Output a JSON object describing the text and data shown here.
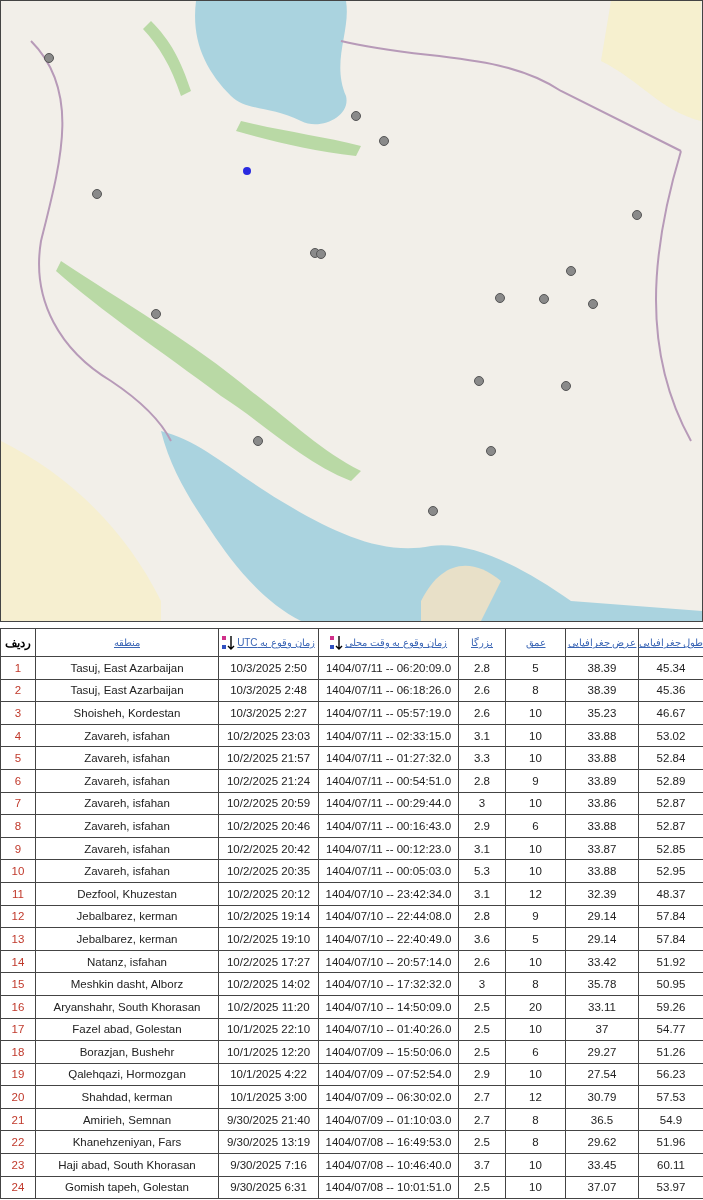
{
  "map": {
    "kind": "street-map"
  },
  "table": {
    "columns": [
      {
        "label": "ردیف",
        "link": false,
        "sortable": false
      },
      {
        "label": "منطقه",
        "link": true,
        "sortable": false
      },
      {
        "label": "زمان وقوع به UTC",
        "link": true,
        "sortable": true
      },
      {
        "label": "زمان وقوع به وقت محلی",
        "link": true,
        "sortable": true
      },
      {
        "label": "بزرگا",
        "link": true,
        "sortable": false
      },
      {
        "label": "عمق",
        "link": true,
        "sortable": false
      },
      {
        "label": "عرض جغرافیایی",
        "link": true,
        "sortable": false
      },
      {
        "label": "طول جغرافیایی",
        "link": true,
        "sortable": false
      }
    ],
    "rows": [
      [
        "1",
        "Tasuj, East Azarbaijan",
        "10/3/2025 2:50",
        "1404/07/11 -- 06:20:09.0",
        "2.8",
        "5",
        "38.39",
        "45.34"
      ],
      [
        "2",
        "Tasuj, East Azarbaijan",
        "10/3/2025 2:48",
        "1404/07/11 -- 06:18:26.0",
        "2.6",
        "8",
        "38.39",
        "45.36"
      ],
      [
        "3",
        "Shoisheh, Kordestan",
        "10/3/2025 2:27",
        "1404/07/11 -- 05:57:19.0",
        "2.6",
        "10",
        "35.23",
        "46.67"
      ],
      [
        "4",
        "Zavareh, isfahan",
        "10/2/2025 23:03",
        "1404/07/11 -- 02:33:15.0",
        "3.1",
        "10",
        "33.88",
        "53.02"
      ],
      [
        "5",
        "Zavareh, isfahan",
        "10/2/2025 21:57",
        "1404/07/11 -- 01:27:32.0",
        "3.3",
        "10",
        "33.88",
        "52.84"
      ],
      [
        "6",
        "Zavareh, isfahan",
        "10/2/2025 21:24",
        "1404/07/11 -- 00:54:51.0",
        "2.8",
        "9",
        "33.89",
        "52.89"
      ],
      [
        "7",
        "Zavareh, isfahan",
        "10/2/2025 20:59",
        "1404/07/11 -- 00:29:44.0",
        "3",
        "10",
        "33.86",
        "52.87"
      ],
      [
        "8",
        "Zavareh, isfahan",
        "10/2/2025 20:46",
        "1404/07/11 -- 00:16:43.0",
        "2.9",
        "6",
        "33.88",
        "52.87"
      ],
      [
        "9",
        "Zavareh, isfahan",
        "10/2/2025 20:42",
        "1404/07/11 -- 00:12:23.0",
        "3.1",
        "10",
        "33.87",
        "52.85"
      ],
      [
        "10",
        "Zavareh, isfahan",
        "10/2/2025 20:35",
        "1404/07/11 -- 00:05:03.0",
        "5.3",
        "10",
        "33.88",
        "52.95"
      ],
      [
        "11",
        "Dezfool, Khuzestan",
        "10/2/2025 20:12",
        "1404/07/10 -- 23:42:34.0",
        "3.1",
        "12",
        "32.39",
        "48.37"
      ],
      [
        "12",
        "Jebalbarez, kerman",
        "10/2/2025 19:14",
        "1404/07/10 -- 22:44:08.0",
        "2.8",
        "9",
        "29.14",
        "57.84"
      ],
      [
        "13",
        "Jebalbarez, kerman",
        "10/2/2025 19:10",
        "1404/07/10 -- 22:40:49.0",
        "3.6",
        "5",
        "29.14",
        "57.84"
      ],
      [
        "14",
        "Natanz, isfahan",
        "10/2/2025 17:27",
        "1404/07/10 -- 20:57:14.0",
        "2.6",
        "10",
        "33.42",
        "51.92"
      ],
      [
        "15",
        "Meshkin dasht, Alborz",
        "10/2/2025 14:02",
        "1404/07/10 -- 17:32:32.0",
        "3",
        "8",
        "35.78",
        "50.95"
      ],
      [
        "16",
        "Aryanshahr, South Khorasan",
        "10/2/2025 11:20",
        "1404/07/10 -- 14:50:09.0",
        "2.5",
        "20",
        "33.11",
        "59.26"
      ],
      [
        "17",
        "Fazel abad, Golestan",
        "10/1/2025 22:10",
        "1404/07/10 -- 01:40:26.0",
        "2.5",
        "10",
        "37",
        "54.77"
      ],
      [
        "18",
        "Borazjan, Bushehr",
        "10/1/2025 12:20",
        "1404/07/09 -- 15:50:06.0",
        "2.5",
        "6",
        "29.27",
        "51.26"
      ],
      [
        "19",
        "Qalehqazi, Hormozgan",
        "10/1/2025 4:22",
        "1404/07/09 -- 07:52:54.0",
        "2.9",
        "10",
        "27.54",
        "56.23"
      ],
      [
        "20",
        "Shahdad, kerman",
        "10/1/2025 3:00",
        "1404/07/09 -- 06:30:02.0",
        "2.7",
        "12",
        "30.79",
        "57.53"
      ],
      [
        "21",
        "Amirieh, Semnan",
        "9/30/2025 21:40",
        "1404/07/09 -- 01:10:03.0",
        "2.7",
        "8",
        "36.5",
        "54.9"
      ],
      [
        "22",
        "Khanehzeniyan, Fars",
        "9/30/2025 13:19",
        "1404/07/08 -- 16:49:53.0",
        "2.5",
        "8",
        "29.62",
        "51.96"
      ],
      [
        "23",
        "Haji abad, South Khorasan",
        "9/30/2025 7:16",
        "1404/07/08 -- 10:46:40.0",
        "3.7",
        "10",
        "33.45",
        "60.11"
      ],
      [
        "24",
        "Gomish tapeh, Golestan",
        "9/30/2025 6:31",
        "1404/07/08 -- 10:01:51.0",
        "2.5",
        "10",
        "37.07",
        "53.97"
      ]
    ]
  }
}
